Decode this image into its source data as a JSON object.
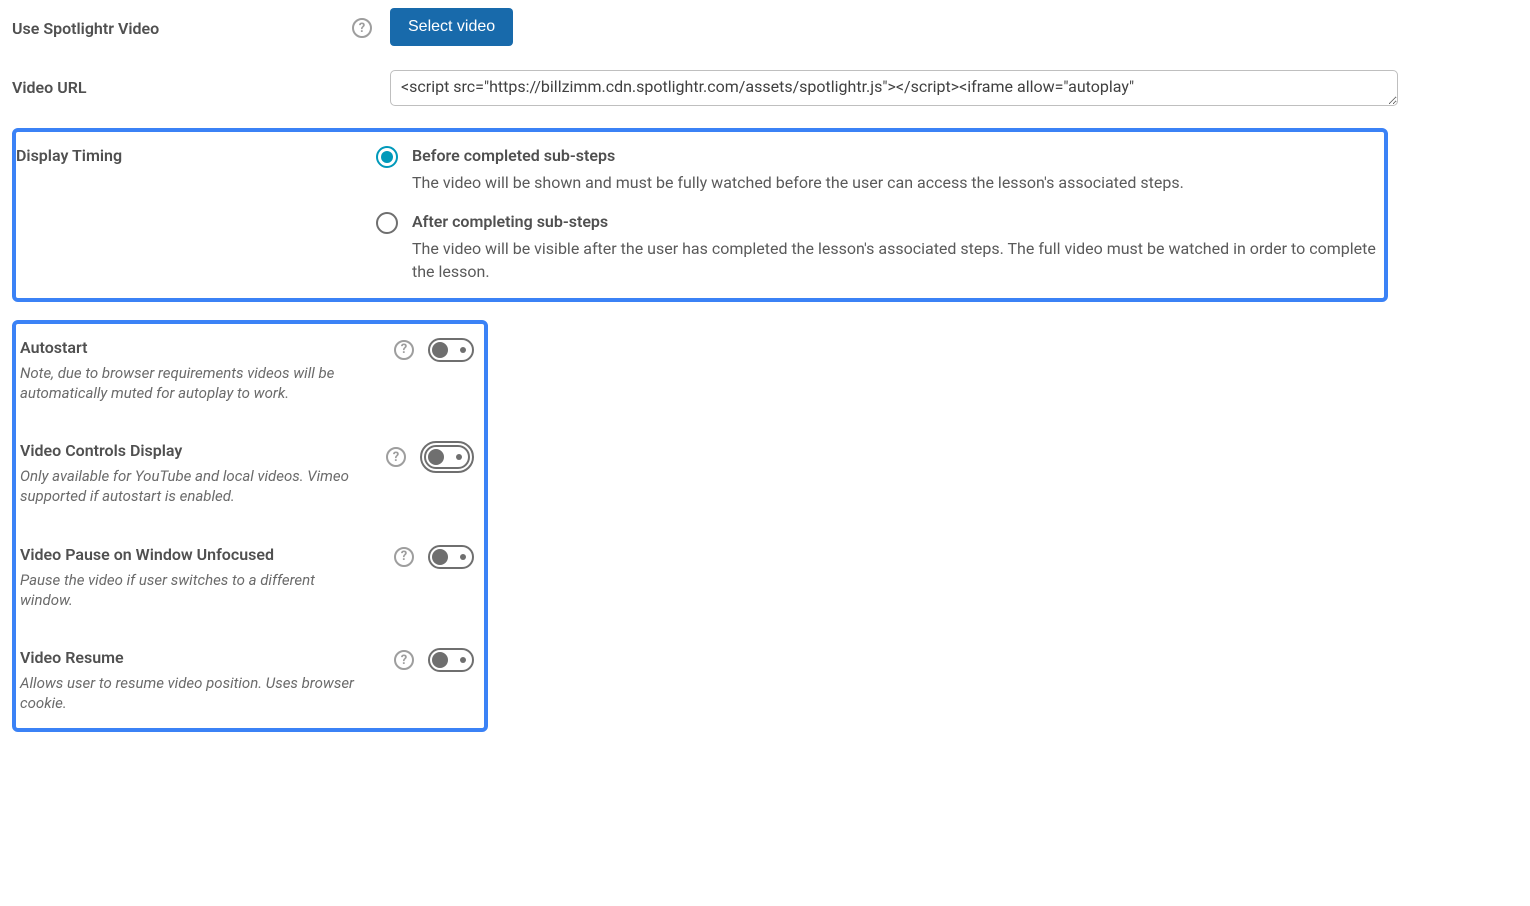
{
  "spotlightr": {
    "label": "Use Spotlightr Video",
    "help_tooltip": "?",
    "button": "Select video"
  },
  "video_url": {
    "label": "Video URL",
    "value": "<script src=\"https://billzimm.cdn.spotlightr.com/assets/spotlightr.js\"></script><iframe allow=\"autoplay\""
  },
  "display_timing": {
    "label": "Display Timing",
    "options": [
      {
        "title": "Before completed sub-steps",
        "desc": "The video will be shown and must be fully watched before the user can access the lesson's associated steps.",
        "selected": true
      },
      {
        "title": "After completing sub-steps",
        "desc": "The video will be visible after the user has completed the lesson's associated steps. The full video must be watched in order to complete the lesson.",
        "selected": false
      }
    ]
  },
  "toggles": [
    {
      "title": "Autostart",
      "desc": "Note, due to browser requirements videos will be automatically muted for autoplay to work.",
      "on": false,
      "focused": false
    },
    {
      "title": "Video Controls Display",
      "desc": "Only available for YouTube and local videos. Vimeo supported if autostart is enabled.",
      "on": false,
      "focused": true
    },
    {
      "title": "Video Pause on Window Unfocused",
      "desc": "Pause the video if user switches to a different window.",
      "on": false,
      "focused": false
    },
    {
      "title": "Video Resume",
      "desc": "Allows user to resume video position. Uses browser cookie.",
      "on": false,
      "focused": false
    }
  ]
}
